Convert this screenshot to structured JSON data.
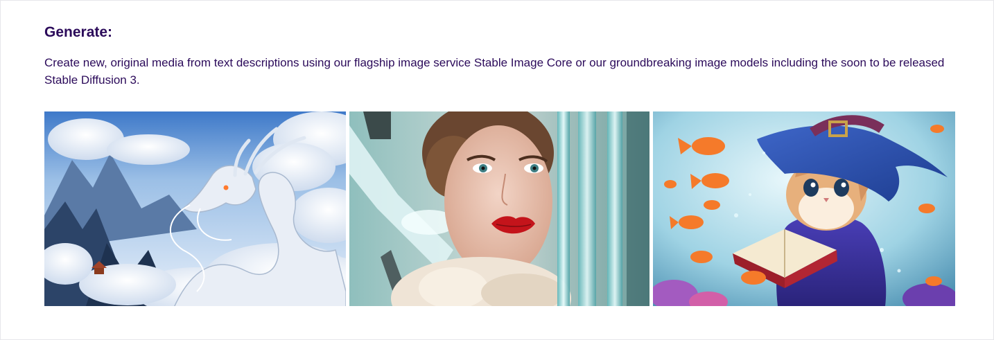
{
  "section": {
    "heading": "Generate:",
    "description": "Create new, original media from text descriptions using our flagship image service Stable Image Core or our groundbreaking image models including the soon to be released Stable Diffusion 3."
  },
  "gallery": {
    "images": [
      {
        "name": "white-dragon-clouds-image"
      },
      {
        "name": "woman-red-lips-portrait-image"
      },
      {
        "name": "wizard-kitten-goldfish-image"
      }
    ]
  },
  "colors": {
    "text": "#2b0a5a",
    "border": "#e6e6ea"
  }
}
